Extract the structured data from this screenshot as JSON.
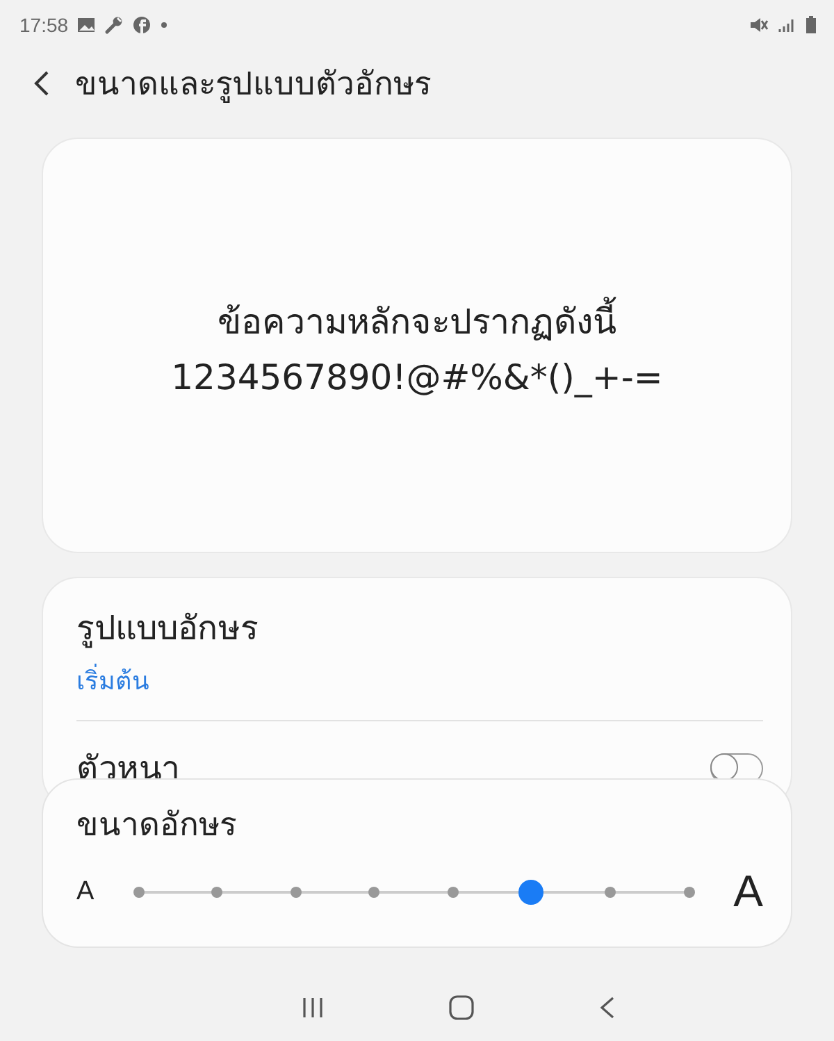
{
  "status_bar": {
    "time": "17:58"
  },
  "header": {
    "title": "ขนาดและรูปแบบตัวอักษร"
  },
  "preview": {
    "lines": [
      "ข้อความหลักจะปรากฏดังนี้",
      "1234567890!@#%&*()_+-="
    ]
  },
  "options": [
    {
      "kind": "link",
      "label": "รูปแบบอักษร",
      "value": "เริ่มต้น"
    },
    {
      "kind": "toggle",
      "label": "ตัวหนา",
      "on": false
    }
  ],
  "font_size": {
    "title": "ขนาดอักษร",
    "small_label": "A",
    "large_label": "A",
    "level": 0.714
  }
}
